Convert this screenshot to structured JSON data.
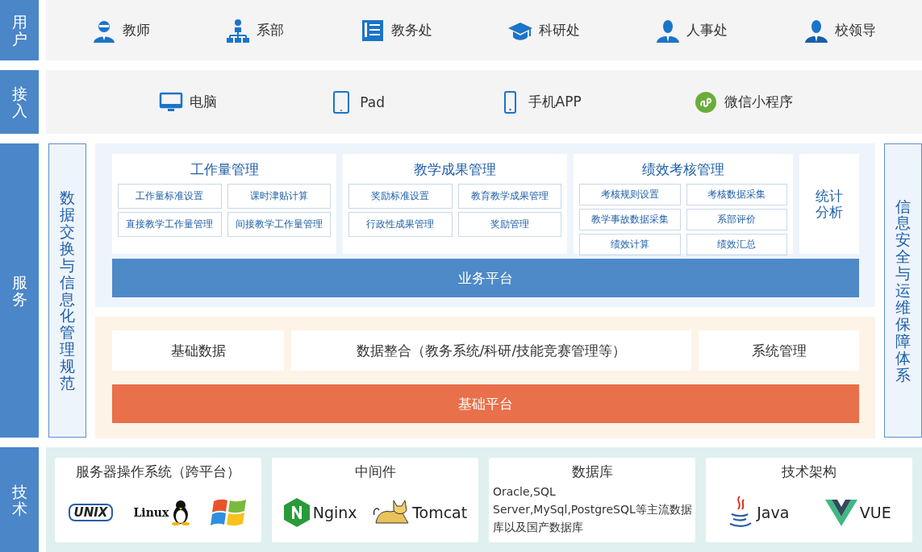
{
  "users": {
    "label": "用户",
    "items": [
      {
        "kind": "teacher",
        "label": "教师"
      },
      {
        "kind": "org",
        "label": "系部"
      },
      {
        "kind": "book",
        "label": "教务处"
      },
      {
        "kind": "cap",
        "label": "科研处"
      },
      {
        "kind": "person",
        "label": "人事处"
      },
      {
        "kind": "leader",
        "label": "校领导"
      }
    ]
  },
  "access": {
    "label": "接入",
    "items": [
      {
        "kind": "pc",
        "label": "电脑"
      },
      {
        "kind": "pad",
        "label": "Pad"
      },
      {
        "kind": "phone",
        "label": "手机APP"
      },
      {
        "kind": "mini",
        "label": "微信小程序"
      }
    ]
  },
  "service": {
    "label": "服务",
    "left_note": "数据交换与信息化管理规范",
    "right_note": "信息安全与运维保障体系",
    "business": {
      "modules": [
        {
          "title": "工作量管理",
          "items": [
            "工作量标准设置",
            "课时津贴计算",
            "直接教学工作量管理",
            "间接教学工作量管理"
          ]
        },
        {
          "title": "教学成果管理",
          "items": [
            "奖励标准设置",
            "教育教学成果管理",
            "行政性成果管理",
            "奖励管理"
          ]
        },
        {
          "title": "绩效考核管理",
          "items": [
            "考核规则设置",
            "考核数据采集",
            "教学事故数据采集",
            "系部评价",
            "绩效计算",
            "绩效汇总"
          ]
        }
      ],
      "stats": "统计分析",
      "platform": "业务平台"
    },
    "base": {
      "items": [
        "基础数据",
        "数据整合（教务系统/科研/技能竞赛管理等）",
        "系统管理"
      ],
      "platform": "基础平台"
    }
  },
  "tech": {
    "label": "技术",
    "cards": [
      {
        "title": "服务器操作系统（跨平台）",
        "kind": "logos",
        "logos": [
          {
            "kind": "unix",
            "text": "UNIX"
          },
          {
            "kind": "linux",
            "text": "Linux"
          },
          {
            "kind": "windows"
          }
        ]
      },
      {
        "title": "中间件",
        "kind": "logos",
        "logos": [
          {
            "kind": "nginx",
            "text": "Nginx"
          },
          {
            "kind": "tomcat",
            "text": "Tomcat"
          }
        ]
      },
      {
        "title": "数据库",
        "kind": "text",
        "lines": [
          "Oracle,SQL",
          "Server,MySql,PostgreSQL等主流数据",
          "库以及国产数据库"
        ]
      },
      {
        "title": "技术架构",
        "kind": "logos",
        "logos": [
          {
            "kind": "java",
            "text": "Java"
          },
          {
            "kind": "vue",
            "text": "VUE"
          }
        ]
      }
    ]
  }
}
